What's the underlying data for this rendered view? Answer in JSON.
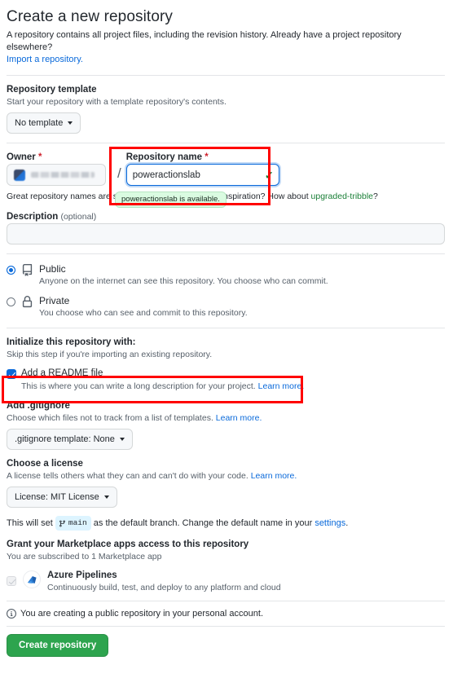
{
  "header": {
    "title": "Create a new repository",
    "lead": "A repository contains all project files, including the revision history. Already have a project repository elsewhere?",
    "import_link": "Import a repository."
  },
  "template_section": {
    "label": "Repository template",
    "note": "Start your repository with a template repository's contents.",
    "button": "No template"
  },
  "owner_section": {
    "owner_label": "Owner",
    "owner_required": "*",
    "owner_value": "",
    "separator": "/",
    "name_label": "Repository name",
    "name_required": "*",
    "name_value": "poweractionslab",
    "name_placeholder": "",
    "availability_tooltip": "poweractionslab is available.",
    "hint_prefix": "Great repository names are short and memorable. Need inspiration? How about ",
    "hint_suggestion": "upgraded-tribble",
    "hint_suffix": "?"
  },
  "description_section": {
    "label": "Description",
    "optional": "(optional)",
    "value": "",
    "placeholder": ""
  },
  "visibility": {
    "public": {
      "title": "Public",
      "desc": "Anyone on the internet can see this repository. You choose who can commit.",
      "selected": true,
      "icon": "repo-icon"
    },
    "private": {
      "title": "Private",
      "desc": "You choose who can see and commit to this repository.",
      "selected": false,
      "icon": "lock-icon"
    }
  },
  "initialize": {
    "heading": "Initialize this repository with:",
    "subheading": "Skip this step if you're importing an existing repository.",
    "readme": {
      "label": "Add a README file",
      "desc": "This is where you can write a long description for your project.",
      "link": "Learn more.",
      "checked": true
    },
    "gitignore": {
      "label": "Add .gitignore",
      "desc": "Choose which files not to track from a list of templates.",
      "link": "Learn more.",
      "button": ".gitignore template: None"
    },
    "license": {
      "label": "Choose a license",
      "desc": "A license tells others what they can and can't do with your code.",
      "link": "Learn more.",
      "button": "License: MIT License"
    }
  },
  "branch_line": {
    "prefix": "This will set",
    "branch": "main",
    "middle": "as the default branch. Change the default name in your",
    "link": "settings",
    "suffix": "."
  },
  "marketplace": {
    "heading": "Grant your Marketplace apps access to this repository",
    "subheading": "You are subscribed to 1 Marketplace app",
    "app": {
      "name": "Azure Pipelines",
      "desc": "Continuously build, test, and deploy to any platform and cloud",
      "checked": true,
      "disabled": true,
      "icon": "azure-pipelines-icon"
    }
  },
  "footer": {
    "info": "You are creating a public repository in your personal account.",
    "submit": "Create repository"
  },
  "colors": {
    "accent": "#0969da",
    "success": "#2da44e",
    "available_bg": "#dafbe1",
    "required": "#cf222e",
    "annotation": "#ff0000",
    "branch_chip_bg": "#ddf4ff"
  }
}
